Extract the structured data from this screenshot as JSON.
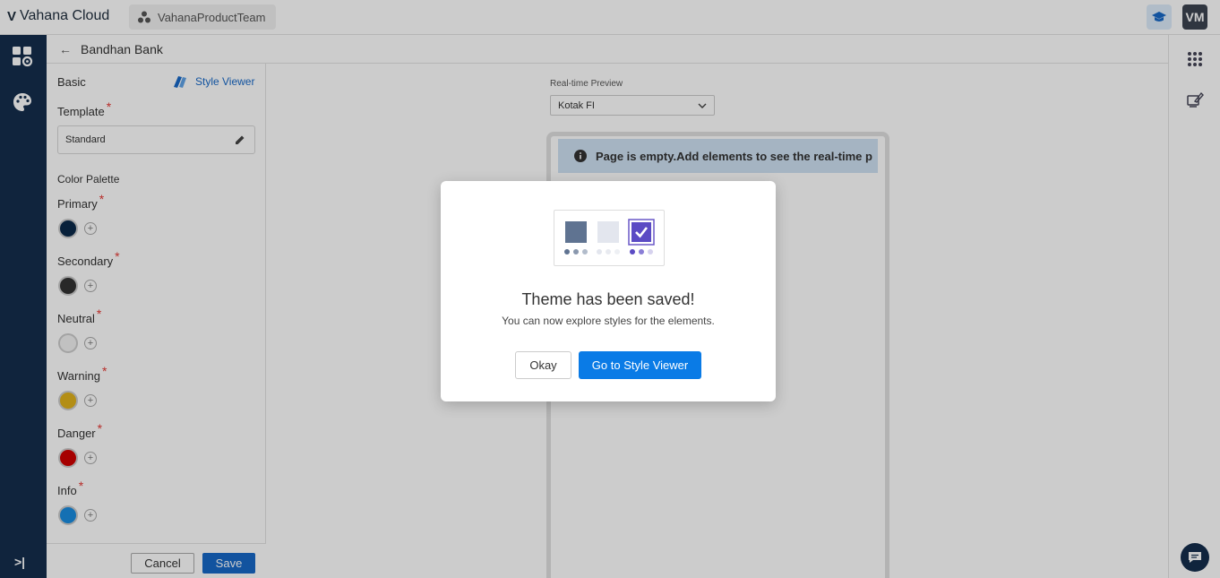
{
  "topbar": {
    "app_name": "Vahana Cloud",
    "team_name": "VahanaProductTeam",
    "avatar_initials": "VM"
  },
  "subheader": {
    "back_label": "←",
    "title": "Bandhan Bank"
  },
  "panel": {
    "section_basic": "Basic",
    "style_viewer_link": "Style Viewer",
    "template_label": "Template",
    "template_value": "Standard",
    "color_palette_label": "Color Palette",
    "required_mark": "*",
    "colors": [
      {
        "label": "Primary",
        "hex": "#0b2a4a"
      },
      {
        "label": "Secondary",
        "hex": "#333333"
      },
      {
        "label": "Neutral",
        "hex": "#f2f2f2"
      },
      {
        "label": "Warning",
        "hex": "#e0b21c"
      },
      {
        "label": "Danger",
        "hex": "#d00000"
      },
      {
        "label": "Info",
        "hex": "#1a8de0"
      }
    ],
    "cancel_label": "Cancel",
    "save_label": "Save"
  },
  "preview": {
    "label": "Real-time Preview",
    "selected_option": "Kotak FI",
    "empty_message": "Page is empty.Add elements to see the real-time p"
  },
  "modal": {
    "title": "Theme has been saved!",
    "subtitle": "You can now explore styles for the elements.",
    "okay_label": "Okay",
    "goto_label": "Go to Style Viewer"
  },
  "colors": {
    "nav_bg": "#142e4d",
    "accent": "#1768c7",
    "modal_primary": "#0a7be6"
  }
}
